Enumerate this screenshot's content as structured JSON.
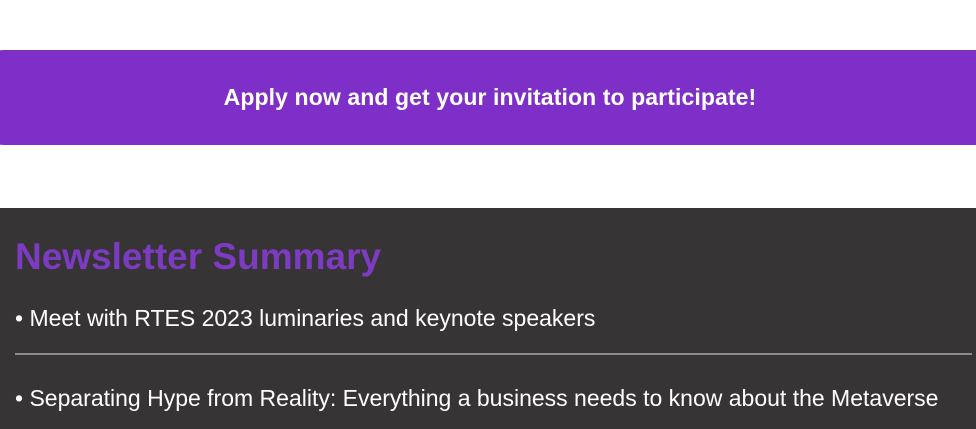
{
  "cta": {
    "label": "Apply now and get your invitation to participate!"
  },
  "newsletter": {
    "title": "Newsletter Summary",
    "items": [
      "• Meet with RTES 2023 luminaries and keynote speakers",
      "• Separating Hype from Reality: Everything a business needs to know about the Metaverse"
    ]
  },
  "colors": {
    "accent": "#7e2fc8",
    "title": "#7d3bc1",
    "panel": "#363435",
    "divider": "#8c8a8b"
  }
}
